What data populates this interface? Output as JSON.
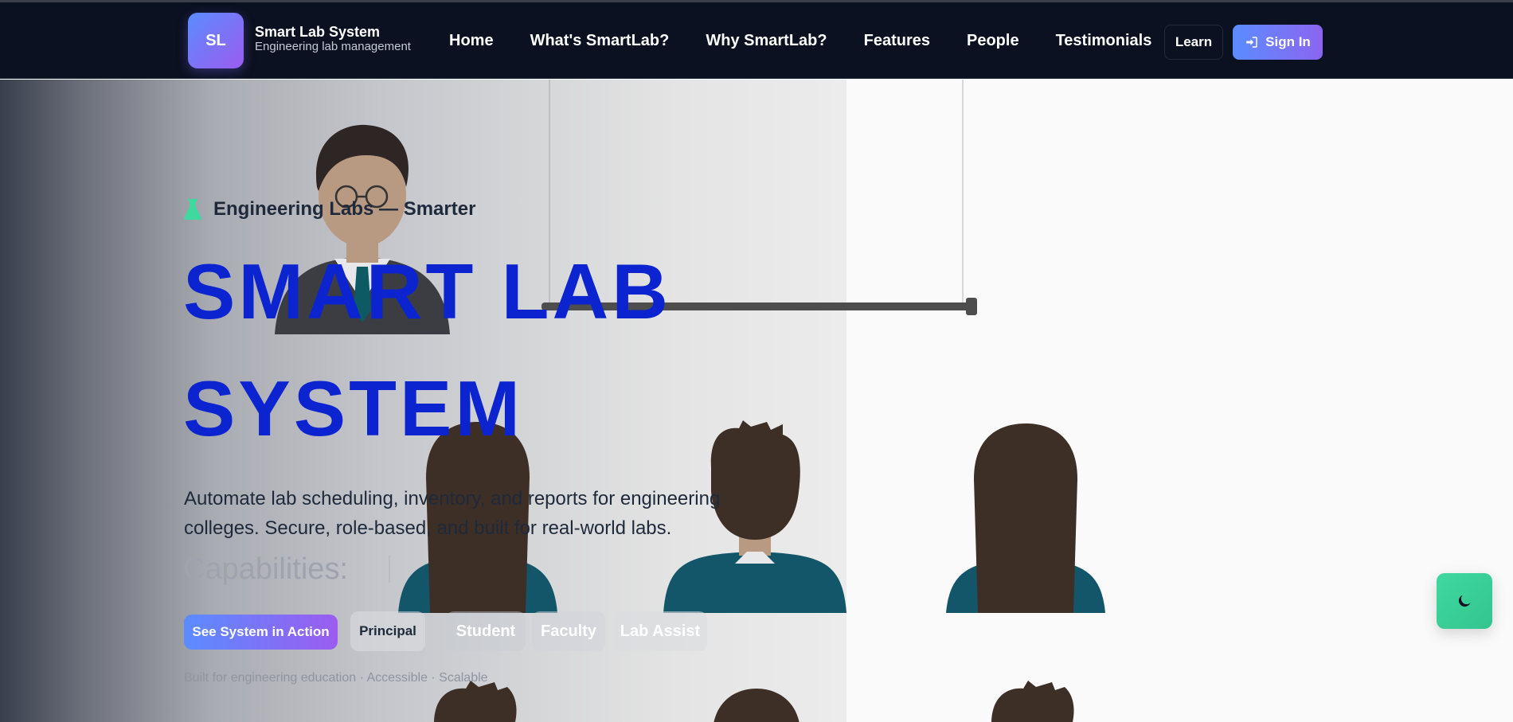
{
  "brand": {
    "logo": "SL",
    "title": "Smart Lab System",
    "subtitle": "Engineering lab management"
  },
  "nav": {
    "links": [
      "Home",
      "What's SmartLab?",
      "Why SmartLab?",
      "Features",
      "People",
      "Testimonials"
    ]
  },
  "actions": {
    "learn": "Learn",
    "signin": "Sign In",
    "signin_icon": "sign-in-icon"
  },
  "hero": {
    "badge_icon": "flask-icon",
    "badge": "Engineering Labs — Smarter",
    "title_line1": "SMART LAB",
    "title_line2": "SYSTEM",
    "description": "Automate lab scheduling, inventory, and reports for engineering colleges. Secure, role-based, and built for real-world labs.",
    "capabilities_label": "Capabilities:",
    "cta": "See System in Action",
    "roles": [
      "Principal",
      "Student",
      "Faculty",
      "Lab Assist"
    ],
    "footnote": "Built for engineering education · Accessible · Scalable"
  },
  "theme_toggle": {
    "icon": "moon-icon"
  },
  "colors": {
    "nav_bg": "#0b1120",
    "accent": "#0b24d0",
    "gradient_start": "#5b8cff",
    "gradient_end": "#9b5cf0",
    "toggle": "#3fd9a0"
  }
}
